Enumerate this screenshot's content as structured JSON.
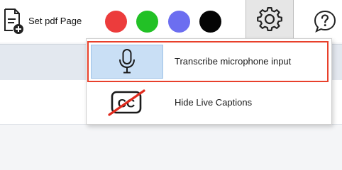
{
  "toolbar": {
    "set_pdf_page_label": "Set pdf Page",
    "swatches": [
      {
        "name": "red",
        "color": "#ec3c3c"
      },
      {
        "name": "green",
        "color": "#22c126"
      },
      {
        "name": "blue",
        "color": "#6c6ef0"
      },
      {
        "name": "black",
        "color": "#050505"
      }
    ],
    "settings_icon": "gear-icon",
    "help_icon": "help-icon"
  },
  "menu": {
    "items": [
      {
        "label": "Transcribe microphone input",
        "icon": "microphone-icon",
        "highlighted": true
      },
      {
        "label": "Hide Live Captions",
        "icon": "closed-captions-off-icon",
        "highlighted": false
      }
    ]
  },
  "colors": {
    "highlight_border": "#e8402b",
    "selected_icon_bg": "#c9dff5",
    "settings_button_bg": "#e6e6e6"
  }
}
